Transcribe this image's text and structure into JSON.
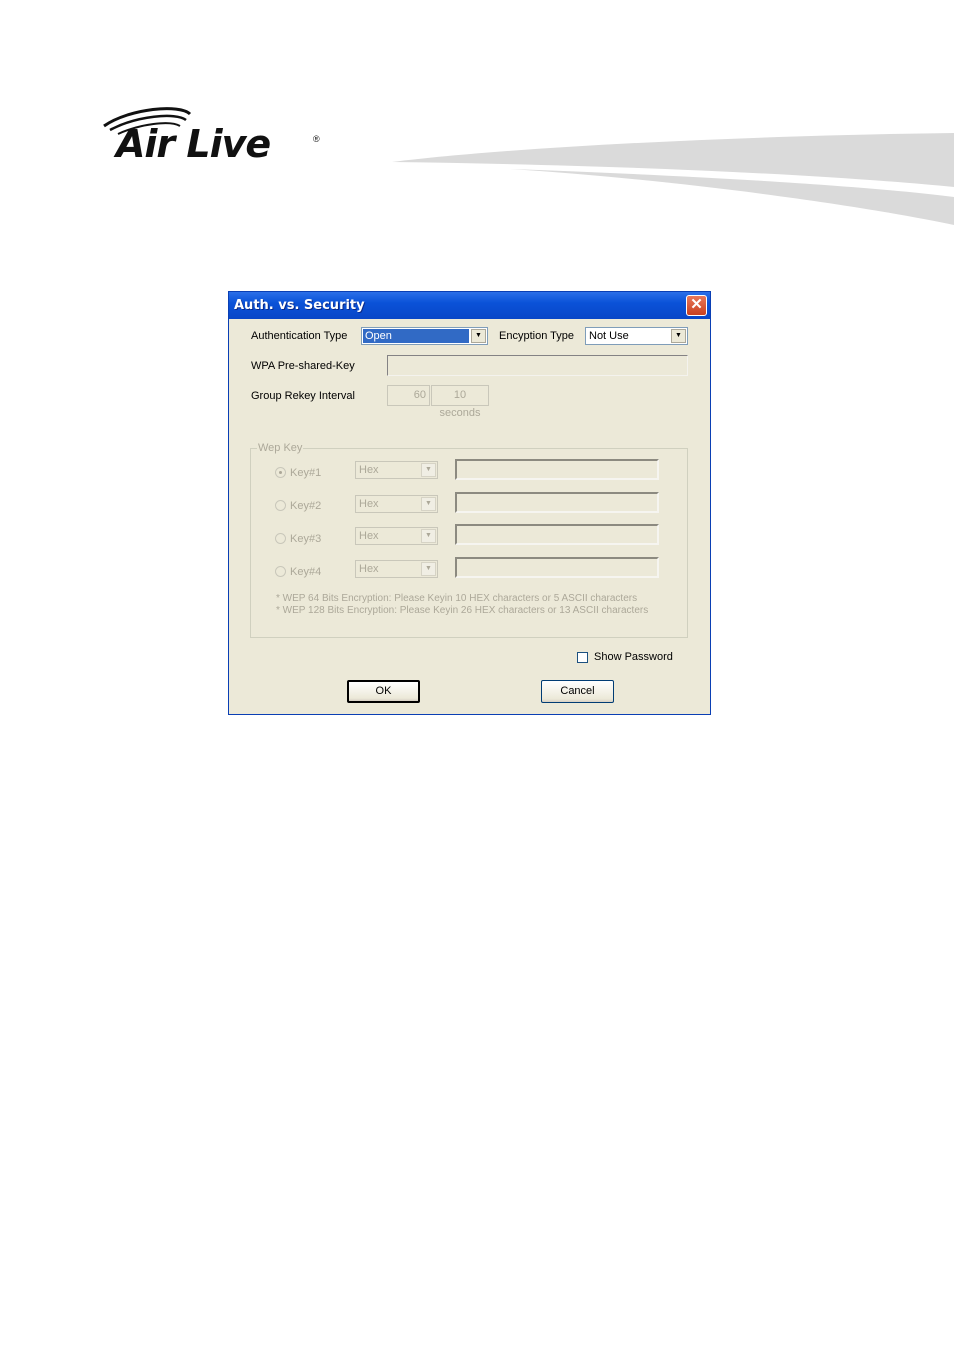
{
  "brand": {
    "logo_text": "Air Live",
    "registered_mark": "®"
  },
  "dialog": {
    "title": "Auth. vs. Security",
    "close_icon": "close-icon",
    "authentication_type": {
      "label": "Authentication Type",
      "value": "Open"
    },
    "encryption_type": {
      "label": "Encyption Type",
      "value": "Not Use"
    },
    "wpa_psk": {
      "label": "WPA Pre-shared-Key",
      "value": ""
    },
    "group_rekey": {
      "label": "Group Rekey Interval",
      "value": "60",
      "unit_button": "10 seconds"
    },
    "wep_key": {
      "group_label": "Wep Key",
      "keys": [
        {
          "label": "Key#1",
          "format": "Hex",
          "value": "",
          "selected": true
        },
        {
          "label": "Key#2",
          "format": "Hex",
          "value": "",
          "selected": false
        },
        {
          "label": "Key#3",
          "format": "Hex",
          "value": "",
          "selected": false
        },
        {
          "label": "Key#4",
          "format": "Hex",
          "value": "",
          "selected": false
        }
      ],
      "notes": [
        "* WEP 64 Bits Encryption:   Please Keyin 10 HEX characters or 5 ASCII characters",
        "* WEP 128 Bits Encryption:  Please Keyin 26 HEX characters or 13 ASCII characters"
      ]
    },
    "show_password": {
      "label": "Show Password",
      "checked": false
    },
    "ok_label": "OK",
    "cancel_label": "Cancel"
  }
}
